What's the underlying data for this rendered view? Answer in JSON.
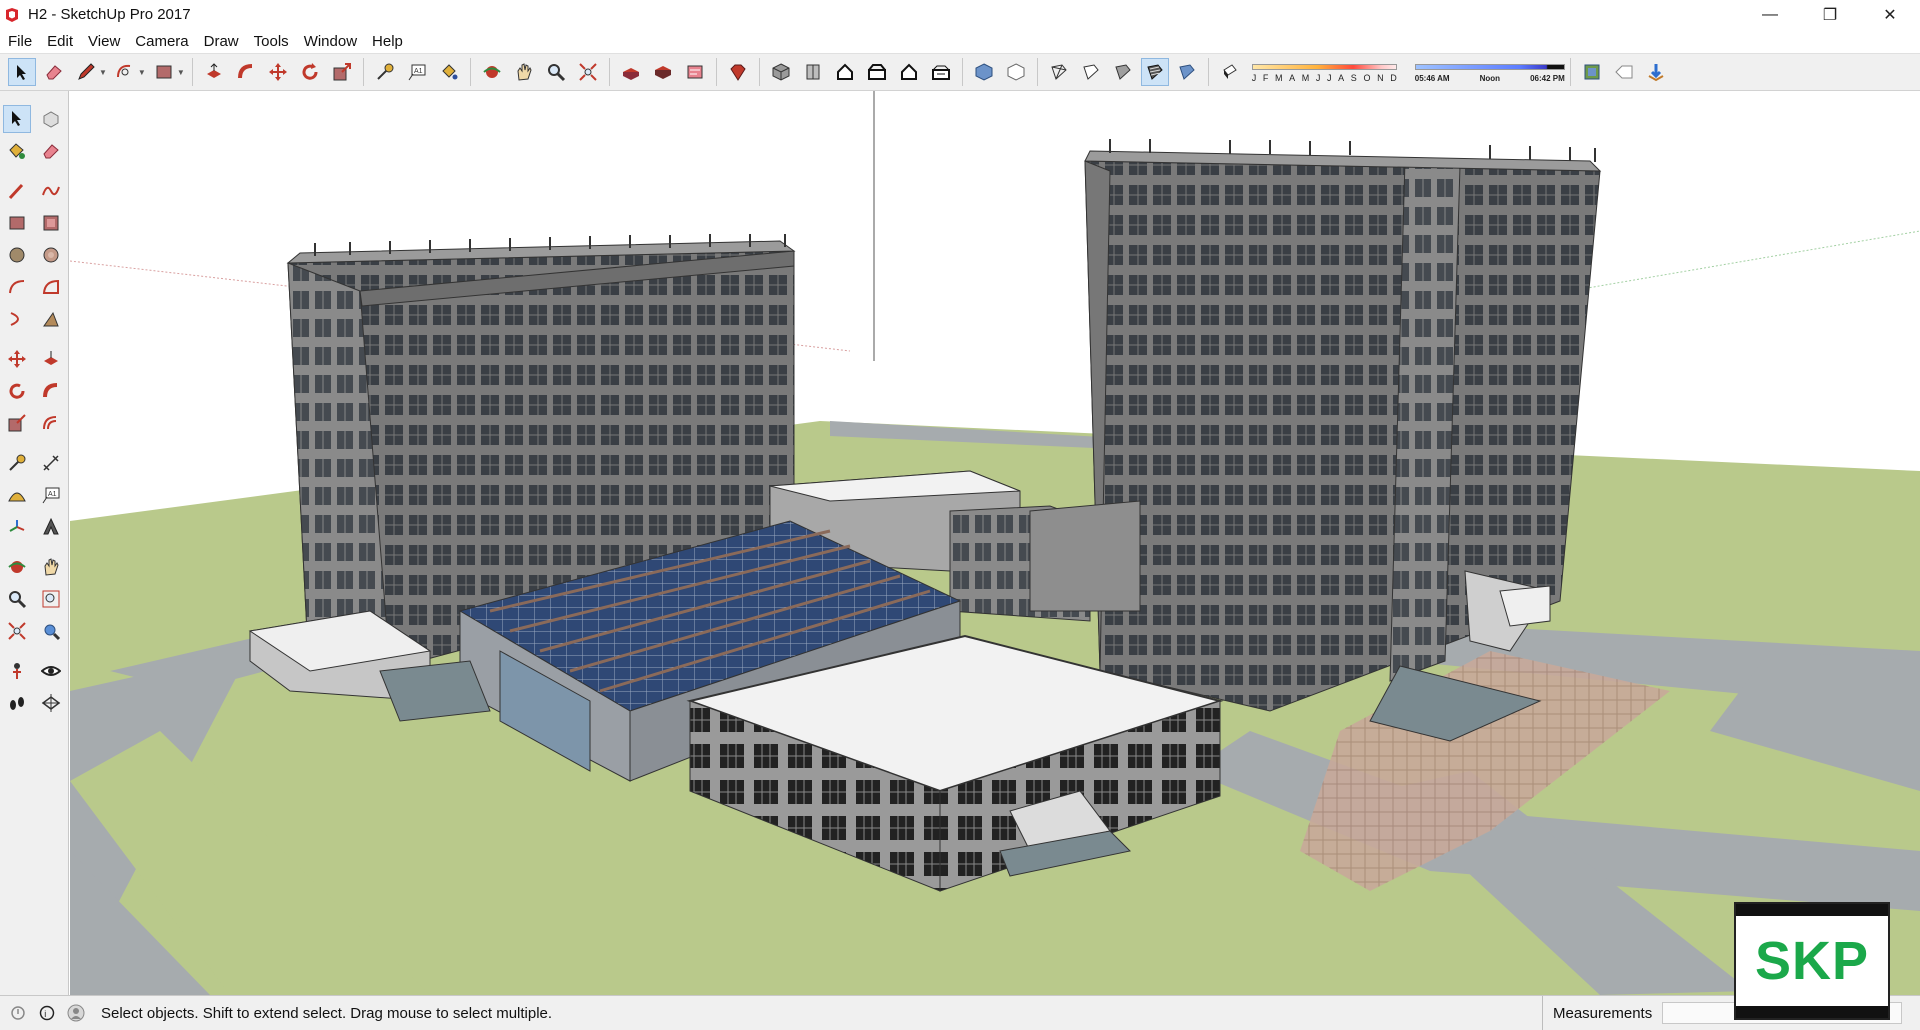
{
  "window": {
    "title": "H2 - SketchUp Pro 2017",
    "controls": {
      "minimize": "—",
      "restore": "❐",
      "close": "✕"
    }
  },
  "menubar": {
    "items": [
      "File",
      "Edit",
      "View",
      "Camera",
      "Draw",
      "Tools",
      "Window",
      "Help"
    ]
  },
  "toolbar": {
    "tools": [
      "select-icon",
      "eraser-icon",
      "pencil-icon",
      "arc-icon",
      "rectangle-icon",
      "push-pull-icon",
      "follow-me-icon",
      "move-icon",
      "rotate-icon",
      "scale-icon",
      "tape-measure-icon",
      "text-icon",
      "paint-bucket-icon",
      "orbit-icon",
      "pan-icon",
      "zoom-icon",
      "zoom-extents-icon",
      "warehouse-icon",
      "extension-warehouse-icon",
      "layout-icon",
      "ruby-icon",
      "iso-view-icon",
      "top-view-icon",
      "front-view-icon",
      "right-view-icon",
      "back-view-icon",
      "left-view-icon",
      "xray-icon",
      "back-edges-icon",
      "wireframe-icon",
      "hidden-line-icon",
      "shaded-icon",
      "shaded-textures-icon",
      "monochrome-icon",
      "shadows-icon"
    ],
    "shadow_months": [
      "J",
      "F",
      "M",
      "A",
      "M",
      "J",
      "J",
      "A",
      "S",
      "O",
      "N",
      "D"
    ],
    "shadow_time": {
      "start": "05:46 AM",
      "mid": "Noon",
      "end": "06:42 PM"
    },
    "extra_tools": [
      "model-info-icon",
      "tag-icon",
      "sandbox-icon"
    ]
  },
  "lefttools": {
    "rows": [
      [
        "select-icon",
        "component-icon"
      ],
      [
        "paint-bucket-icon",
        "eraser-icon"
      ],
      [
        "pencil-icon",
        "freehand-icon"
      ],
      [
        "rectangle-icon",
        "rotated-rectangle-icon"
      ],
      [
        "circle-icon",
        "polygon-icon"
      ],
      [
        "arc-icon",
        "pie-icon"
      ],
      [
        "two-point-arc-icon",
        "three-point-arc-icon"
      ],
      [
        "move-icon",
        "push-pull-icon"
      ],
      [
        "rotate-icon",
        "follow-me-icon"
      ],
      [
        "scale-icon",
        "offset-icon"
      ],
      [
        "tape-measure-icon",
        "dimension-icon"
      ],
      [
        "protractor-icon",
        "text-icon"
      ],
      [
        "axes-icon",
        "3d-text-icon"
      ],
      [
        "orbit-icon",
        "pan-icon"
      ],
      [
        "zoom-icon",
        "zoom-window-icon"
      ],
      [
        "zoom-extents-icon",
        "previous-view-icon"
      ],
      [
        "position-camera-icon",
        "look-around-icon"
      ],
      [
        "walk-icon",
        "section-plane-icon"
      ]
    ]
  },
  "statusbar": {
    "message": "Select objects. Shift to extend select. Drag mouse to select multiple.",
    "measurements_label": "Measurements",
    "measurements_value": ""
  },
  "badge": {
    "text": "SKP"
  },
  "colors": {
    "grass": "#b9c98b",
    "road": "#a6abae",
    "building": "#8d8d8d",
    "accent_green": "#1ba84a"
  }
}
